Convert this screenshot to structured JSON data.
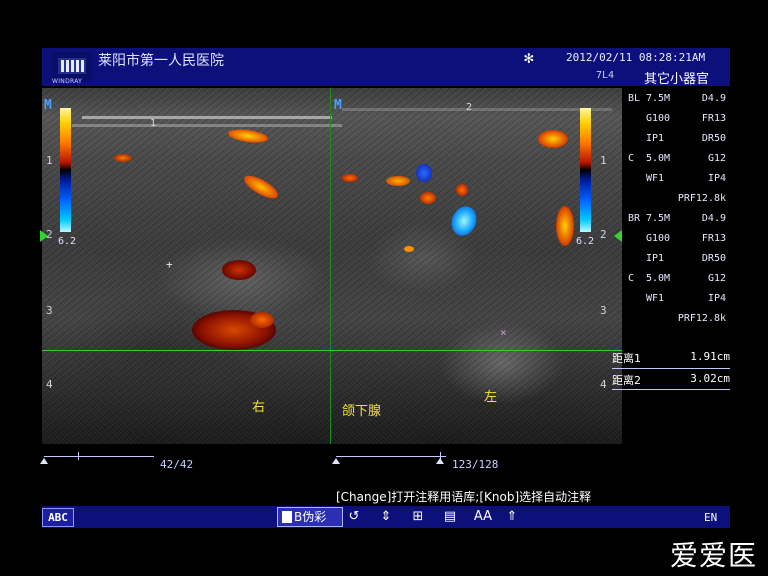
{
  "header": {
    "logo_text": "WINDRAY",
    "hospital": "莱阳市第一人民医院",
    "datetime": "2012/02/11  08:28:21AM",
    "probe": "7L4",
    "organ": "其它小器官",
    "icon": "snowflake-freeze-icon"
  },
  "image": {
    "depth_left": [
      "1",
      "2",
      "3",
      "4"
    ],
    "depth_right": [
      "1",
      "2",
      "3",
      "4"
    ],
    "colorbar_left": {
      "top": "",
      "bottom": "6.2"
    },
    "colorbar_right": {
      "top": "",
      "bottom": "6.2"
    },
    "marker_labels": {
      "m_left": "M",
      "m_right": "M",
      "cursor_1": "1",
      "cursor_2": "2"
    },
    "annotations": {
      "right": "右",
      "center": "颌下腺",
      "left": "左"
    },
    "colors": {
      "grid_green": "#38c838",
      "accent_blue": "#0d0f7a",
      "annotation_yellow": "#f2e22e"
    }
  },
  "params": {
    "rows": [
      [
        "BL",
        "7.5M",
        "D4.9"
      ],
      [
        "",
        "G100",
        "FR13"
      ],
      [
        "",
        "IP1",
        "DR50"
      ],
      [
        "C",
        "5.0M",
        "G12"
      ],
      [
        "",
        "WF1",
        "IP4"
      ],
      [
        "",
        "",
        "PRF12.8k"
      ],
      [
        "BR",
        "7.5M",
        "D4.9"
      ],
      [
        "",
        "G100",
        "FR13"
      ],
      [
        "",
        "IP1",
        "DR50"
      ],
      [
        "C",
        "5.0M",
        "G12"
      ],
      [
        "",
        "WF1",
        "IP4"
      ],
      [
        "",
        "",
        "PRF12.8k"
      ]
    ],
    "measurements": [
      {
        "label": "距离1",
        "value": "1.91cm"
      },
      {
        "label": "距离2",
        "value": "3.02cm"
      }
    ]
  },
  "cine": {
    "left_frames": "42/42",
    "right_frames": "123/128",
    "left_position": 1.0,
    "right_position": 0.96
  },
  "hint": "[Change]打开注释用语库;[Knob]选择自动注释",
  "bottom": {
    "abc_label": "ABC",
    "bcolor_label": "B伪彩",
    "tools": [
      "↺",
      "⇕",
      "⊞",
      "▤",
      "AA",
      "⇑"
    ],
    "lang": "EN"
  },
  "watermark": "爱爱医"
}
